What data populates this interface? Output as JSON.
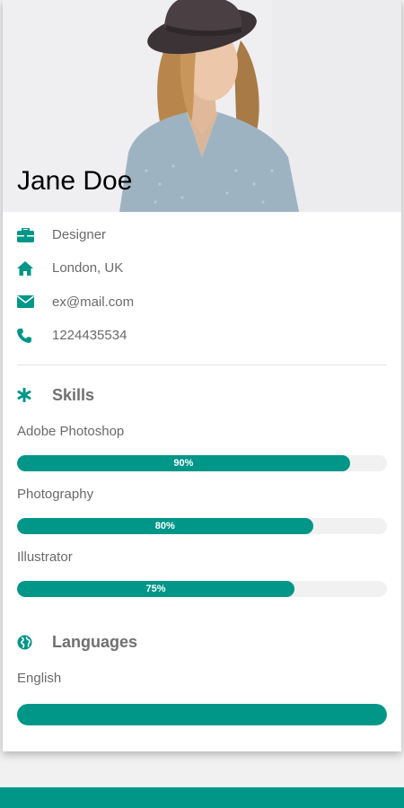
{
  "colors": {
    "accent": "#009688",
    "bar_track": "#f1f1f1"
  },
  "profile": {
    "name": "Jane Doe",
    "photo_alt": "Woman in a dark hat and blue shirt"
  },
  "info": [
    {
      "icon": "briefcase-icon",
      "text": "Designer"
    },
    {
      "icon": "home-icon",
      "text": "London, UK"
    },
    {
      "icon": "envelope-icon",
      "text": "ex@mail.com"
    },
    {
      "icon": "phone-icon",
      "text": "1224435534"
    }
  ],
  "skills": {
    "title": "Skills",
    "icon": "asterisk-icon",
    "items": [
      {
        "name": "Adobe Photoshop",
        "percent": 90,
        "label": "90%"
      },
      {
        "name": "Photography",
        "percent": 80,
        "label": "80%"
      },
      {
        "name": "Illustrator",
        "percent": 75,
        "label": "75%"
      }
    ]
  },
  "languages": {
    "title": "Languages",
    "icon": "globe-icon",
    "items": [
      {
        "name": "English",
        "percent": 100,
        "label": ""
      }
    ]
  }
}
